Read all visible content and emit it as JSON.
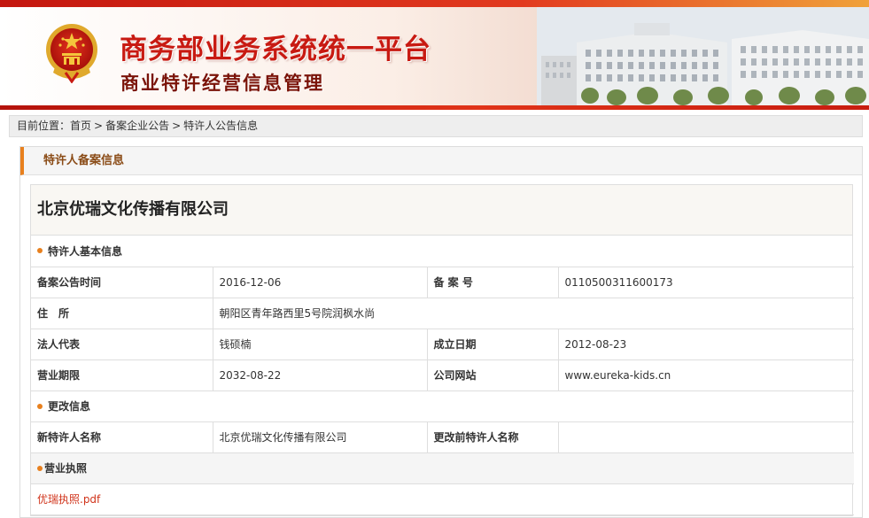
{
  "banner": {
    "title": "商务部业务系统统一平台",
    "subtitle": "商业特许经营信息管理",
    "colors": {
      "brand_red": "#c81a12",
      "subtitle_red": "#7a1308",
      "accent_orange": "#e8801e"
    }
  },
  "breadcrumb": {
    "prefix": "目前位置：",
    "items": [
      "首页",
      "备案企业公告",
      "特许人公告信息"
    ],
    "separator": ">"
  },
  "panel": {
    "title": "特许人备案信息",
    "company_name": "北京优瑞文化传播有限公司",
    "basic_info": {
      "section_title": "特许人基本信息",
      "announce_time_label": "备案公告时间",
      "announce_time": "2016-12-06",
      "record_no_label": "备 案 号",
      "record_no": "0110500311600173",
      "address_label": "住　所",
      "address": "朝阳区青年路西里5号院润枫水尚",
      "legal_rep_label": "法人代表",
      "legal_rep": "钱硕楠",
      "founded_label": "成立日期",
      "founded": "2012-08-23",
      "term_label": "营业期限",
      "term": "2032-08-22",
      "website_label": "公司网站",
      "website": "www.eureka-kids.cn"
    },
    "change_info": {
      "section_title": "更改信息",
      "new_name_label": "新特许人名称",
      "new_name": "北京优瑞文化传播有限公司",
      "old_name_label": "更改前特许人名称",
      "old_name": ""
    },
    "license": {
      "section_title": "营业执照",
      "file_link": "优瑞执照.pdf"
    }
  }
}
